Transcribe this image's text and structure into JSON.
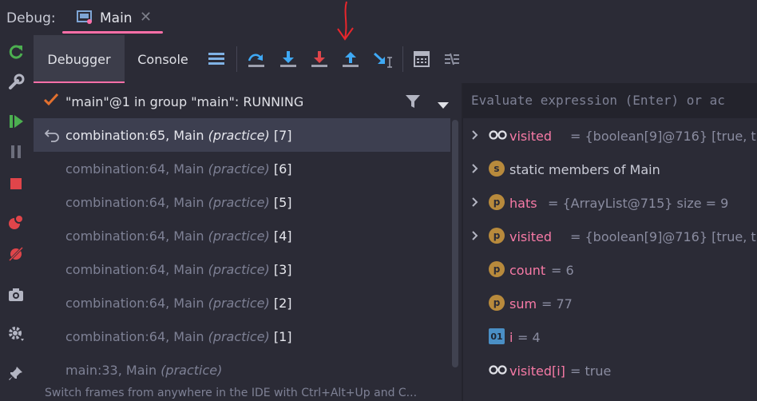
{
  "topbar": {
    "debug_label": "Debug:",
    "tab_label": "Main"
  },
  "toolbar": {
    "tabs": [
      "Debugger",
      "Console"
    ]
  },
  "frames": {
    "thread": "\"main\"@1 in group \"main\": RUNNING",
    "items": [
      {
        "method": "combination:65, Main",
        "pkg": "(practice)",
        "index": "[7]"
      },
      {
        "method": "combination:64, Main",
        "pkg": "(practice)",
        "index": "[6]"
      },
      {
        "method": "combination:64, Main",
        "pkg": "(practice)",
        "index": "[5]"
      },
      {
        "method": "combination:64, Main",
        "pkg": "(practice)",
        "index": "[4]"
      },
      {
        "method": "combination:64, Main",
        "pkg": "(practice)",
        "index": "[3]"
      },
      {
        "method": "combination:64, Main",
        "pkg": "(practice)",
        "index": "[2]"
      },
      {
        "method": "combination:64, Main",
        "pkg": "(practice)",
        "index": "[1]"
      },
      {
        "method": "main:33, Main",
        "pkg": "(practice)",
        "index": ""
      }
    ],
    "hint": "Switch frames from anywhere in the IDE with Ctrl+Alt+Up and C..."
  },
  "evaluate": {
    "placeholder": "Evaluate expression (Enter) or ac"
  },
  "variables": [
    {
      "name": "visited",
      "value": "= {boolean[9]@716} [true, true,",
      "icon": "watch-glasses-icon",
      "expandable": true
    },
    {
      "name": "static members of Main",
      "value": "",
      "icon": "static-badge-icon",
      "expandable": true
    },
    {
      "name": "hats",
      "value": "= {ArrayList@715}  size = 9",
      "icon": "field-badge-icon",
      "expandable": true
    },
    {
      "name": "visited",
      "value": "= {boolean[9]@716} [true, true,",
      "icon": "field-badge-icon",
      "expandable": true
    },
    {
      "name": "count",
      "value": "= 6",
      "icon": "field-badge-icon",
      "expandable": false
    },
    {
      "name": "sum",
      "value": "= 77",
      "icon": "field-badge-icon",
      "expandable": false
    },
    {
      "name": "i",
      "value": "= 4",
      "icon": "local-var-icon",
      "expandable": false
    },
    {
      "name": "visited[i]",
      "value": "= true",
      "icon": "watch-glasses-icon",
      "expandable": false
    }
  ],
  "colors": {
    "accent": "#ff6fa8",
    "var_name": "#f77aa6",
    "selected_row": "#3d3f50"
  }
}
